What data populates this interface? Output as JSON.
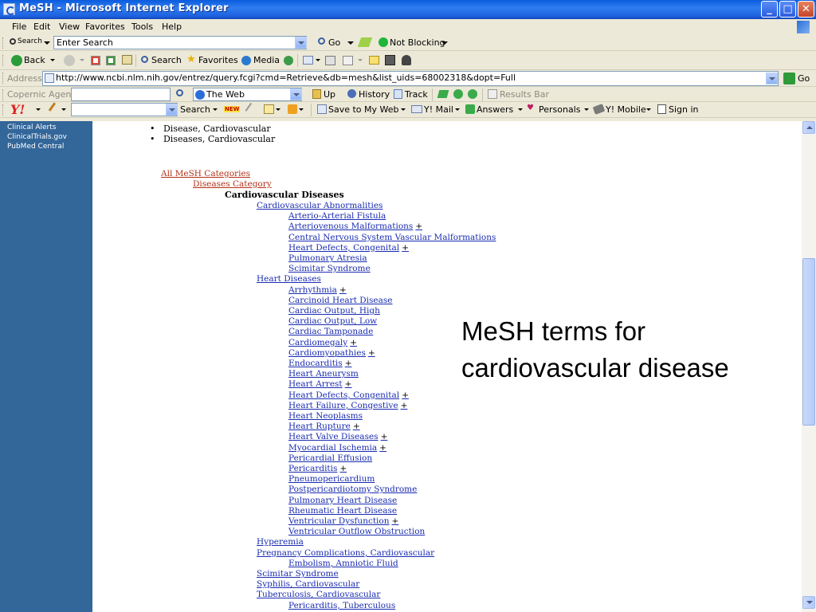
{
  "window": {
    "title": "MeSH - Microsoft Internet Explorer",
    "controls": {
      "minimize": "_",
      "maximize": "□",
      "close": "✕"
    }
  },
  "menu": [
    "File",
    "Edit",
    "View",
    "Favorites",
    "Tools",
    "Help"
  ],
  "search_toolbar": {
    "label": "Search",
    "input_value": "Enter Search",
    "go_label": "Go",
    "popup_label": "Not Blocking"
  },
  "nav_toolbar": {
    "back_label": "Back",
    "search_label": "Search",
    "favorites_label": "Favorites",
    "media_label": "Media"
  },
  "address_bar": {
    "label": "Address",
    "url": "http://www.ncbi.nlm.nih.gov/entrez/query.fcgi?cmd=Retrieve&db=mesh&list_uids=68002318&dopt=Full",
    "go_label": "Go"
  },
  "copernic_bar": {
    "label": "Copernic Agent",
    "scope_value": "The Web",
    "up_label": "Up",
    "history_label": "History",
    "track_label": "Track",
    "results_label": "Results Bar"
  },
  "yahoo_bar": {
    "logo": "Y!",
    "search_label": "Search",
    "new_badge": "NEW",
    "save_label": "Save to My Web",
    "mail_label": "Y! Mail",
    "answers_label": "Answers",
    "personals_label": "Personals",
    "mobile_label": "Y! Mobile",
    "signin_label": "Sign in"
  },
  "sidebar": {
    "links": [
      "Clinical Alerts",
      "ClinicalTrials.gov",
      "PubMed Central"
    ]
  },
  "entry_terms": [
    "Disease, Cardiovascular",
    "Diseases, Cardiovascular"
  ],
  "tree": {
    "root": "All MeSH Categories",
    "category": "Diseases Category",
    "current": "Cardiovascular Diseases",
    "items": [
      {
        "label": "Cardiovascular Abnormalities",
        "level": 1,
        "plus": ""
      },
      {
        "label": "Arterio-Arterial Fistula",
        "level": 2,
        "plus": ""
      },
      {
        "label": "Arteriovenous Malformations",
        "level": 2,
        "plus": "+"
      },
      {
        "label": "Central Nervous System Vascular Malformations",
        "level": 2,
        "plus": ""
      },
      {
        "label": "Heart Defects, Congenital",
        "level": 2,
        "plus": "+"
      },
      {
        "label": "Pulmonary Atresia",
        "level": 2,
        "plus": ""
      },
      {
        "label": "Scimitar Syndrome",
        "level": 2,
        "plus": ""
      },
      {
        "label": "Heart Diseases",
        "level": 1,
        "plus": ""
      },
      {
        "label": "Arrhythmia",
        "level": 2,
        "plus": "+"
      },
      {
        "label": "Carcinoid Heart Disease",
        "level": 2,
        "plus": ""
      },
      {
        "label": "Cardiac Output, High",
        "level": 2,
        "plus": ""
      },
      {
        "label": "Cardiac Output, Low",
        "level": 2,
        "plus": ""
      },
      {
        "label": "Cardiac Tamponade",
        "level": 2,
        "plus": ""
      },
      {
        "label": "Cardiomegaly",
        "level": 2,
        "plus": "+"
      },
      {
        "label": "Cardiomyopathies",
        "level": 2,
        "plus": "+"
      },
      {
        "label": "Endocarditis",
        "level": 2,
        "plus": "+"
      },
      {
        "label": "Heart Aneurysm",
        "level": 2,
        "plus": ""
      },
      {
        "label": "Heart Arrest",
        "level": 2,
        "plus": "+"
      },
      {
        "label": "Heart Defects, Congenital",
        "level": 2,
        "plus": "+"
      },
      {
        "label": "Heart Failure, Congestive",
        "level": 2,
        "plus": "+"
      },
      {
        "label": "Heart Neoplasms",
        "level": 2,
        "plus": ""
      },
      {
        "label": "Heart Rupture",
        "level": 2,
        "plus": "+"
      },
      {
        "label": "Heart Valve Diseases",
        "level": 2,
        "plus": "+"
      },
      {
        "label": "Myocardial Ischemia",
        "level": 2,
        "plus": "+"
      },
      {
        "label": "Pericardial Effusion",
        "level": 2,
        "plus": ""
      },
      {
        "label": "Pericarditis",
        "level": 2,
        "plus": "+"
      },
      {
        "label": "Pneumopericardium",
        "level": 2,
        "plus": ""
      },
      {
        "label": "Postpericardiotomy Syndrome",
        "level": 2,
        "plus": ""
      },
      {
        "label": "Pulmonary Heart Disease",
        "level": 2,
        "plus": ""
      },
      {
        "label": "Rheumatic Heart Disease",
        "level": 2,
        "plus": ""
      },
      {
        "label": "Ventricular Dysfunction",
        "level": 2,
        "plus": "+"
      },
      {
        "label": "Ventricular Outflow Obstruction",
        "level": 2,
        "plus": ""
      },
      {
        "label": "Hyperemia",
        "level": 1,
        "plus": ""
      },
      {
        "label": "Pregnancy Complications, Cardiovascular",
        "level": 1,
        "plus": ""
      },
      {
        "label": "Embolism, Amniotic Fluid",
        "level": 2,
        "plus": ""
      },
      {
        "label": "Scimitar Syndrome",
        "level": 1,
        "plus": ""
      },
      {
        "label": "Syphilis, Cardiovascular",
        "level": 1,
        "plus": ""
      },
      {
        "label": "Tuberculosis, Cardiovascular",
        "level": 1,
        "plus": ""
      },
      {
        "label": "Pericarditis, Tuberculous",
        "level": 2,
        "plus": ""
      }
    ]
  },
  "overlay": {
    "line1": "MeSH terms for",
    "line2": "cardiovascular disease"
  },
  "colors": {
    "sidebar": "#336699",
    "link": "#1a2cb0",
    "link_visited": "#b33218",
    "titlebar": "#0a5cde"
  }
}
